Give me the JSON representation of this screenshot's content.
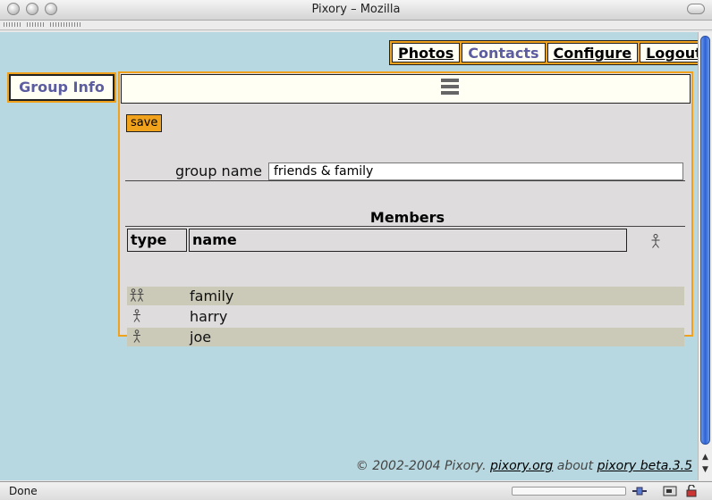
{
  "window": {
    "title": "Pixory – Mozilla"
  },
  "nav": {
    "items": [
      {
        "label": "Photos",
        "active": false
      },
      {
        "label": "Contacts",
        "active": true
      },
      {
        "label": "Configure",
        "active": false
      },
      {
        "label": "Logout",
        "active": false
      }
    ]
  },
  "sidebar": {
    "label": "Group Info"
  },
  "panel": {
    "save_label": "save",
    "group_name_label": "group name",
    "group_name_value": "friends & family",
    "members_title": "Members",
    "columns": [
      "type",
      "name"
    ],
    "rows": [
      {
        "type_icon": "group-icon",
        "name": "family"
      },
      {
        "type_icon": "person-icon",
        "name": "harry"
      },
      {
        "type_icon": "person-icon",
        "name": "joe"
      }
    ]
  },
  "footer": {
    "copyright": "© 2002-2004 Pixory.",
    "site_link": "pixory.org",
    "about_text": "about",
    "version_link": "pixory beta.3.5"
  },
  "status": {
    "text": "Done"
  },
  "colors": {
    "accent": "#f0a21c",
    "background": "#b7d8e0",
    "panel": "#dedcdc",
    "active_tab_text": "#5c5ca0"
  }
}
